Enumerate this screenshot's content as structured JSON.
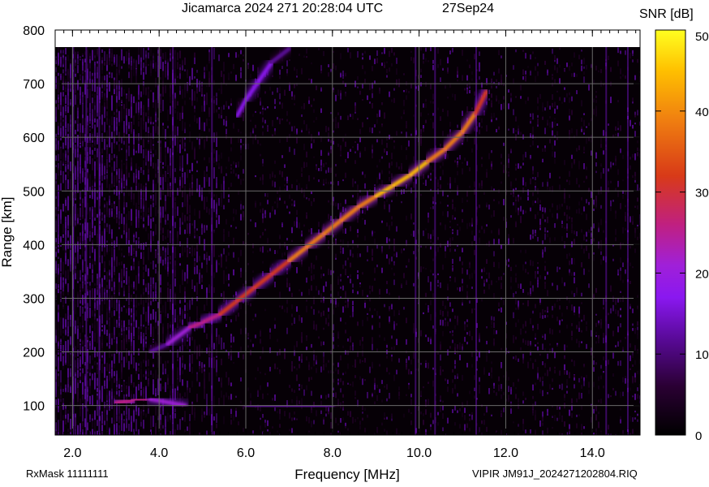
{
  "header": {
    "title": "Jicamarca 2024 271 20:28:04 UTC",
    "date": "27Sep24"
  },
  "footer": {
    "rxmask": "RxMask 11111111",
    "file": "VIPIR  JM91J_2024271202804.RIQ"
  },
  "colors": {
    "background": "#ffffff",
    "plot_background": "#060006",
    "grid": "#6a6a6a",
    "colormap": [
      "#000000",
      "#2a0033",
      "#5a0a9a",
      "#8a18f0",
      "#a020d8",
      "#c02080",
      "#d83a18",
      "#f08010",
      "#ffc000",
      "#ffff20"
    ]
  },
  "chart_data": {
    "type": "heatmap",
    "title": "Jicamarca 2024 271 20:28:04 UTC",
    "xlabel": "Frequency [MHz]",
    "ylabel": "Range [km]",
    "xlim": [
      1.6,
      15.1
    ],
    "ylim": [
      45,
      800
    ],
    "xticks": [
      2.0,
      4.0,
      6.0,
      8.0,
      10.0,
      12.0,
      14.0
    ],
    "xtick_labels": [
      "2.0",
      "4.0",
      "6.0",
      "8.0",
      "10.0",
      "12.0",
      "14.0"
    ],
    "yticks": [
      100,
      200,
      300,
      400,
      500,
      600,
      700,
      800
    ],
    "ytick_labels": [
      "100",
      "200",
      "300",
      "400",
      "500",
      "600",
      "700",
      "800"
    ],
    "grid": true,
    "colorbar": {
      "label": "SNR [dB]",
      "range": [
        0,
        50
      ],
      "ticks": [
        0,
        10,
        20,
        30,
        40,
        50
      ],
      "tick_labels": [
        "0",
        "10",
        "20",
        "30",
        "40",
        "50"
      ]
    },
    "traces": [
      {
        "layer": "F",
        "points": [
          [
            3.8,
            200,
            12
          ],
          [
            4.2,
            215,
            14
          ],
          [
            4.7,
            245,
            25
          ],
          [
            5.0,
            255,
            28
          ],
          [
            5.4,
            270,
            30
          ],
          [
            5.8,
            295,
            32
          ],
          [
            6.2,
            320,
            33
          ],
          [
            6.6,
            345,
            34
          ],
          [
            7.0,
            370,
            36
          ],
          [
            7.4,
            395,
            38
          ],
          [
            7.8,
            420,
            39
          ],
          [
            8.2,
            445,
            40
          ],
          [
            8.6,
            470,
            41
          ],
          [
            9.0,
            490,
            42
          ],
          [
            9.4,
            510,
            43
          ],
          [
            9.8,
            530,
            43
          ],
          [
            10.2,
            555,
            42
          ],
          [
            10.6,
            578,
            40
          ],
          [
            11.0,
            610,
            39
          ],
          [
            11.3,
            645,
            37
          ],
          [
            11.55,
            685,
            32
          ]
        ]
      },
      {
        "layer": "F-2hop",
        "points": [
          [
            5.8,
            640,
            14
          ],
          [
            6.0,
            670,
            16
          ],
          [
            6.3,
            705,
            17
          ],
          [
            6.6,
            740,
            15
          ],
          [
            7.0,
            765,
            12
          ]
        ]
      },
      {
        "layer": "E",
        "points": [
          [
            2.6,
            105,
            18
          ],
          [
            3.0,
            105,
            28
          ],
          [
            3.4,
            110,
            30
          ],
          [
            3.8,
            112,
            28
          ],
          [
            4.6,
            100,
            15
          ],
          [
            6.0,
            100,
            12
          ],
          [
            8.0,
            98,
            10
          ],
          [
            10.0,
            98,
            9
          ],
          [
            12.0,
            98,
            8
          ],
          [
            14.0,
            98,
            7
          ],
          [
            15.0,
            98,
            6
          ]
        ]
      }
    ]
  }
}
